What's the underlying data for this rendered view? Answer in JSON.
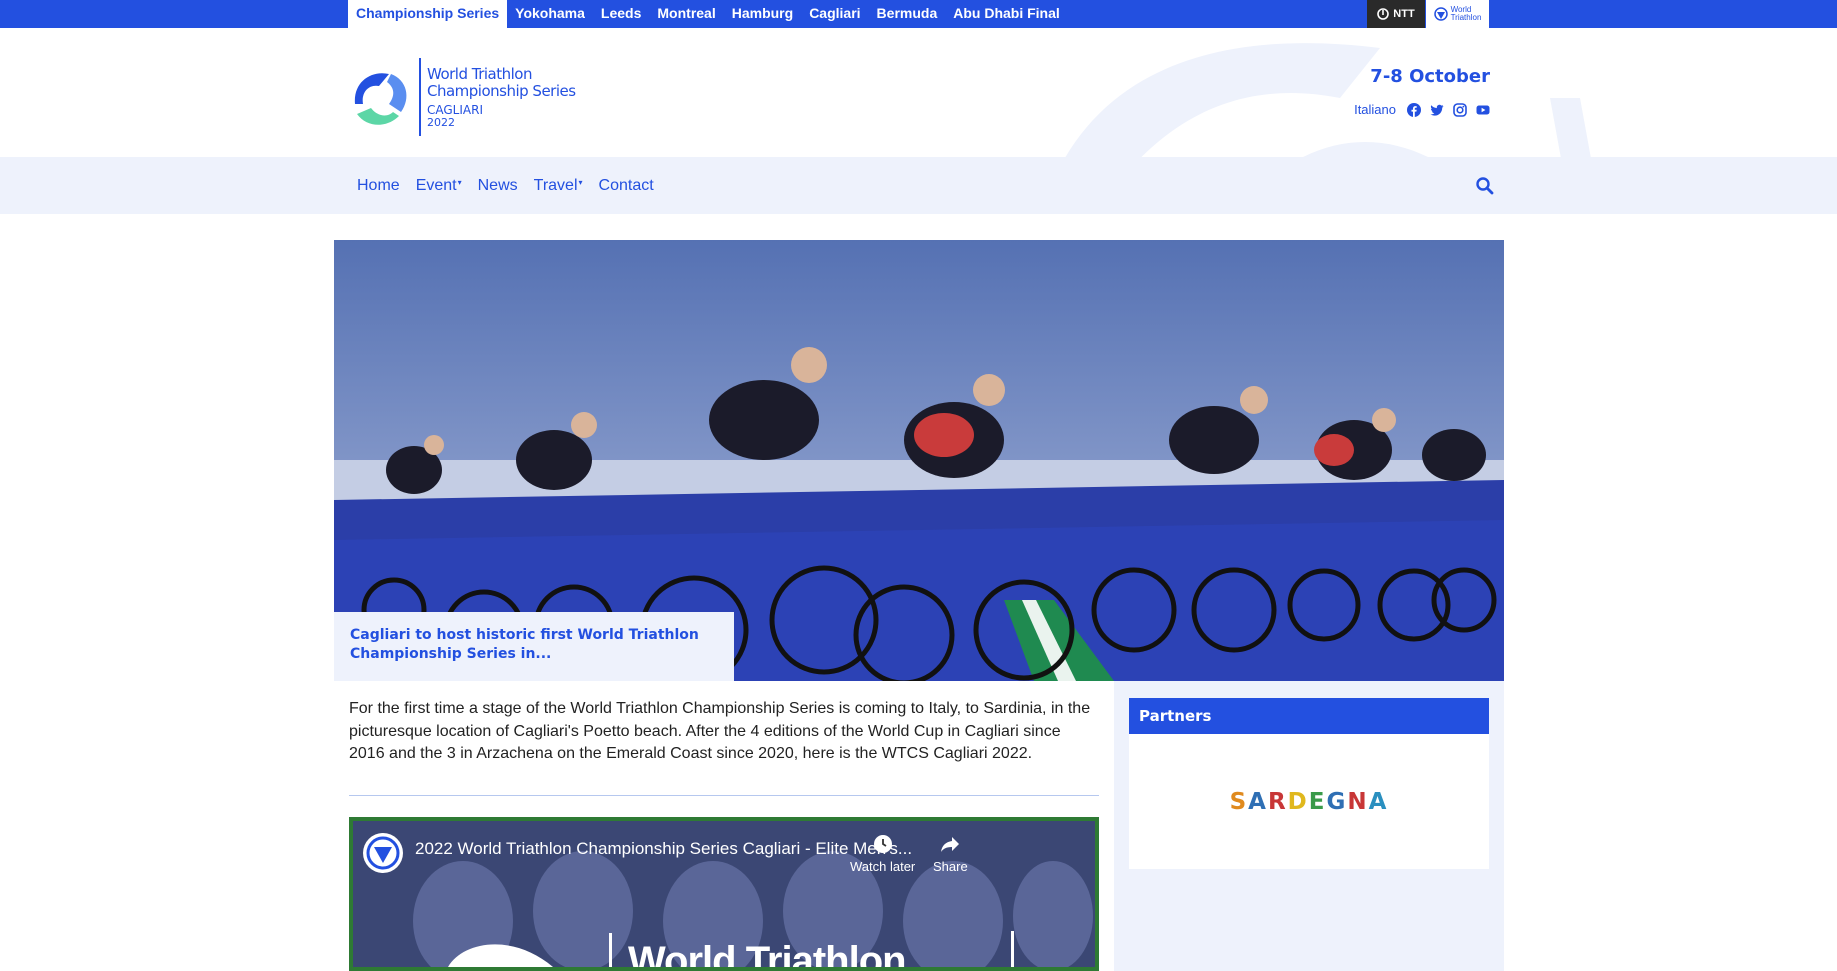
{
  "topbar": {
    "links": [
      {
        "label": "Championship Series",
        "active": true
      },
      {
        "label": "Yokohama"
      },
      {
        "label": "Leeds"
      },
      {
        "label": "Montreal"
      },
      {
        "label": "Hamburg"
      },
      {
        "label": "Cagliari"
      },
      {
        "label": "Bermuda"
      },
      {
        "label": "Abu Dhabi Final"
      }
    ],
    "sponsor_ntt": "NTT",
    "sponsor_wt_line1": "World",
    "sponsor_wt_line2": "Triathlon"
  },
  "logo": {
    "line1": "World Triathlon",
    "line2": "Championship Series",
    "city": "CAGLIARI",
    "year": "2022"
  },
  "header": {
    "date": "7-8 October",
    "language": "Italiano",
    "social_icons": [
      "facebook-icon",
      "twitter-icon",
      "instagram-icon",
      "youtube-icon"
    ]
  },
  "nav": {
    "items": [
      {
        "label": "Home",
        "dropdown": false
      },
      {
        "label": "Event",
        "dropdown": true
      },
      {
        "label": "News",
        "dropdown": false
      },
      {
        "label": "Travel",
        "dropdown": true
      },
      {
        "label": "Contact",
        "dropdown": false
      }
    ],
    "search_icon": "search-icon"
  },
  "hero": {
    "caption": "Cagliari to host historic first World Triathlon Championship Series in..."
  },
  "intro": "For the first time a stage of the World Triathlon Championship Series is coming to Italy, to Sardinia, in the picturesque location of Cagliari's Poetto beach. After the 4 editions of the World Cup in Cagliari since 2016 and the 3 in Arzachena on the Emerald Coast since 2020, here is the WTCS Cagliari 2022.",
  "video": {
    "title": "2022 World Triathlon Championship Series Cagliari - Elite Men's...",
    "watch_later": "Watch later",
    "share": "Share",
    "brand_text": "World Triathlon"
  },
  "sidebar": {
    "partners_title": "Partners",
    "partner_logo_text": "SARDEGNA"
  },
  "colors": {
    "brand_blue": "#2350e0",
    "light_bg": "#eef2fc"
  }
}
